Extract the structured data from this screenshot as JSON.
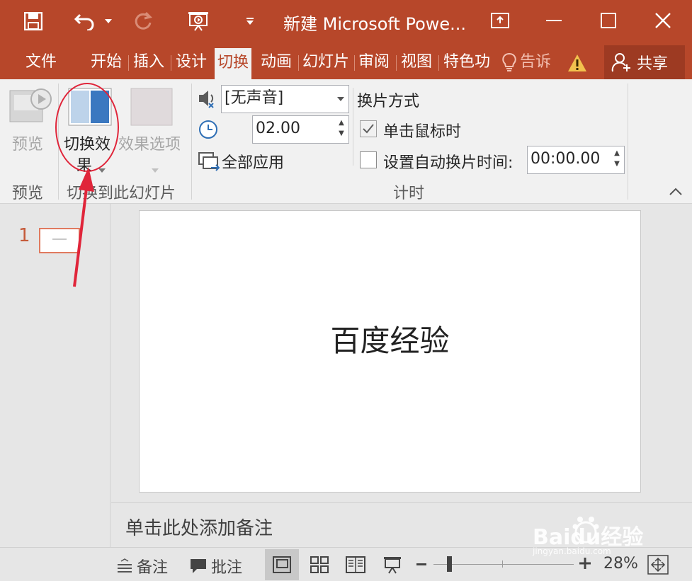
{
  "window": {
    "title": "新建 Microsoft Powe...",
    "accent_color": "#b7472a",
    "controls": [
      "restore-ribbon-icon",
      "minimize-icon",
      "maximize-icon",
      "close-icon"
    ]
  },
  "quick_access": {
    "items": [
      "save-icon",
      "undo-icon",
      "undo-dropdown-icon",
      "redo-icon",
      "present-icon",
      "customize-dropdown-icon"
    ]
  },
  "tabs": [
    {
      "label": "文件",
      "active": false
    },
    {
      "label": "开始",
      "active": false
    },
    {
      "label": "插入",
      "active": false
    },
    {
      "label": "设计",
      "active": false
    },
    {
      "label": "切换",
      "active": true
    },
    {
      "label": "动画",
      "active": false
    },
    {
      "label": "幻灯片",
      "active": false
    },
    {
      "label": "审阅",
      "active": false
    },
    {
      "label": "视图",
      "active": false
    },
    {
      "label": "特色功",
      "active": false
    },
    {
      "label": "告诉",
      "active": false
    }
  ],
  "share_label": "共享",
  "ribbon": {
    "preview_group": {
      "button_label": "预览",
      "group_label": "预览"
    },
    "transition_group": {
      "effects_label_line1": "切换效",
      "effects_label_line2": "果",
      "options_label": "效果选项",
      "group_label": "切换到此幻灯片"
    },
    "timing_group": {
      "sound_value": "[无声音]",
      "duration_value": "02.00",
      "apply_all_label": "全部应用",
      "advance_heading": "换片方式",
      "on_click_label": "单击鼠标时",
      "on_click_checked": true,
      "auto_advance_label": "设置自动换片时间:",
      "auto_advance_checked": false,
      "auto_advance_value": "00:00.00",
      "group_label": "计时"
    }
  },
  "slides": [
    {
      "number": "1",
      "title": "百度经验"
    }
  ],
  "notes_placeholder": "单击此处添加备注",
  "statusbar": {
    "notes_label": "备注",
    "comments_label": "批注",
    "zoom_value": "28%",
    "zoom_level_percent": 28
  },
  "watermark": {
    "brand": "Baidu经验",
    "url": "jingyan.baidu.com"
  }
}
